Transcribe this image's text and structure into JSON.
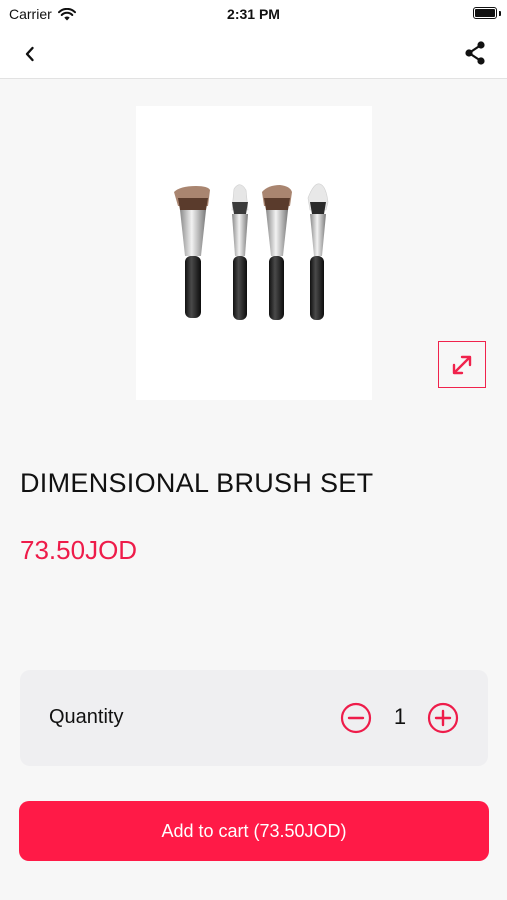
{
  "status_bar": {
    "carrier": "Carrier",
    "time": "2:31 PM"
  },
  "nav": {
    "back_icon": "chevron-left-icon",
    "share_icon": "share-icon"
  },
  "product": {
    "title": "DIMENSIONAL BRUSH SET",
    "price": "73.50JOD",
    "image": "four-makeup-brushes"
  },
  "quantity": {
    "label": "Quantity",
    "value": "1"
  },
  "cart_button": {
    "label": "Add to cart (73.50JOD)"
  },
  "colors": {
    "accent": "#ff1a47",
    "price": "#ee1c4a",
    "background": "#f7f7f7",
    "card": "#efeff1"
  }
}
